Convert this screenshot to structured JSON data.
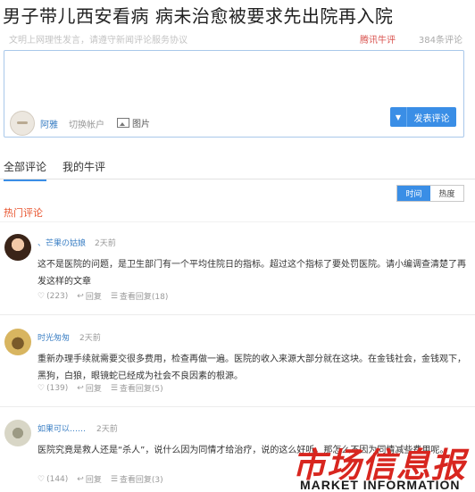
{
  "article": {
    "title": "男子带儿西安看病  病未治愈被要求先出院再入院",
    "notice": "文明上网理性发言，请遵守新闻评论服务协议",
    "brand": "腾讯牛评",
    "comment_count": "384条评论"
  },
  "editor": {
    "username": "阿雅",
    "switch_account": "切换帐户",
    "picture": "图片",
    "submit": "发表评论"
  },
  "tabs": [
    "全部评论",
    "我的牛评"
  ],
  "sort": [
    "时间",
    "热度"
  ],
  "hot_heading": "热门评论",
  "comments": [
    {
      "name": "、芒果の姑娘",
      "time": "2天前",
      "text": "这不是医院的问题，是卫生部门有一个平均住院日的指标。超过这个指标了要处罚医院。请小编调查清楚了再发这样的文章",
      "likes": "(223)",
      "reply": "回复",
      "view_replies": "查看回复(18)"
    },
    {
      "name": "时光匆匆",
      "time": "2天前",
      "text": "重新办理手续就需要交很多费用，检查再做一遍。医院的收入来源大部分就在这块。在金钱社会，金钱观下，黑狗，白狼，眼镜蛇已经成为社会不良因素的根源。",
      "likes": "(139)",
      "reply": "回复",
      "view_replies": "查看回复(5)"
    },
    {
      "name": "如果可以……",
      "time": "2天前",
      "text": "医院究竟是救人还是“杀人”，说什么因为同情才给治疗，说的这么好听，那怎么不因为同情减些费用呢。",
      "likes": "(144)",
      "reply": "回复",
      "view_replies": "查看回复(3)"
    }
  ],
  "watermark": {
    "chinese": "市场信息报",
    "english": "MARKET INFORMATION"
  },
  "colors": {
    "accent": "#3a8ee6",
    "brand_red": "#d9534f",
    "hot_orange": "#e8542e",
    "link_blue": "#3b7fc4"
  }
}
